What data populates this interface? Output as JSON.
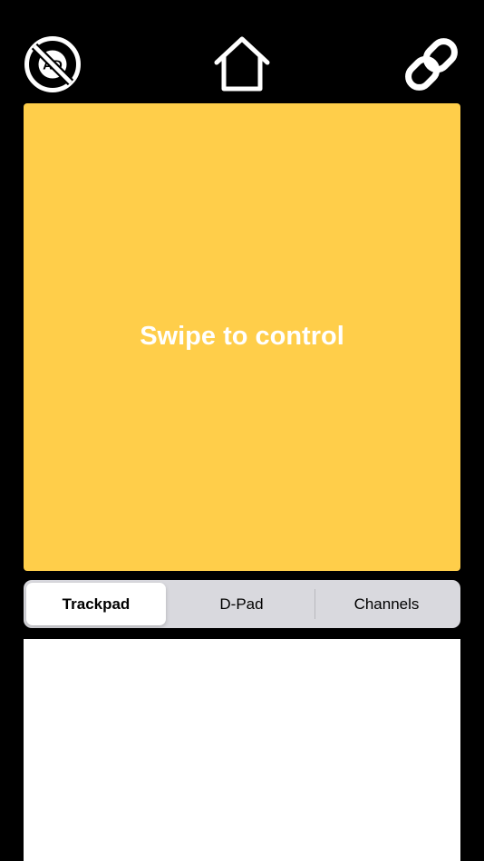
{
  "header": {
    "icons": {
      "left": "no-ads-icon",
      "center": "home-icon",
      "right": "link-icon"
    },
    "no_ads_badge_text": "AD"
  },
  "trackpad": {
    "label": "Swipe to control",
    "color": "#FFCE4A"
  },
  "segmented_control": {
    "segments": [
      {
        "label": "Trackpad",
        "selected": true
      },
      {
        "label": "D-Pad",
        "selected": false
      },
      {
        "label": "Channels",
        "selected": false
      }
    ]
  }
}
